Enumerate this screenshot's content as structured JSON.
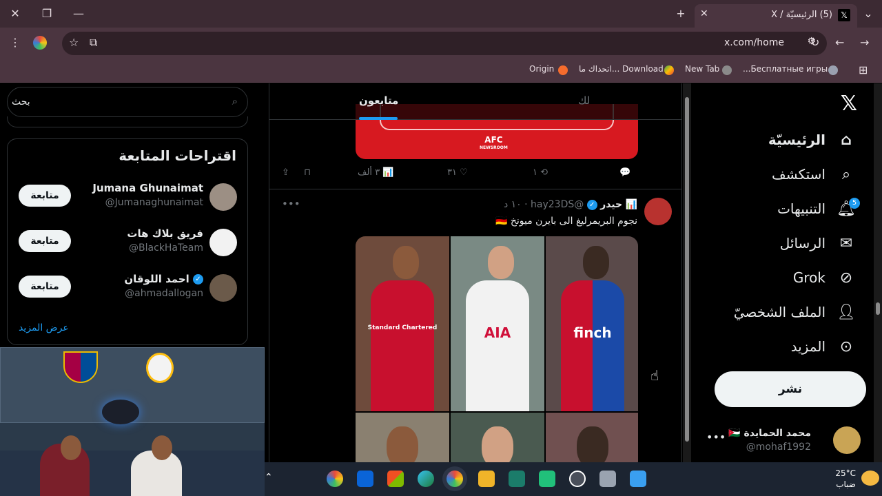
{
  "browser": {
    "tab_title": "(5) الرئيسيّة / X",
    "url": "x.com/home",
    "bookmarks": [
      {
        "label": "Origin"
      },
      {
        "label": "Download ...اتحداك ما"
      },
      {
        "label": "New Tab"
      },
      {
        "label": "Бесплатные игры..."
      }
    ]
  },
  "nav": {
    "items": [
      {
        "label": "الرئيسيّة",
        "icon": "home-icon"
      },
      {
        "label": "استكشف",
        "icon": "search-icon"
      },
      {
        "label": "التنبيهات",
        "icon": "bell-icon",
        "badge": "5"
      },
      {
        "label": "الرسائل",
        "icon": "mail-icon"
      },
      {
        "label": "Grok",
        "icon": "grok-icon"
      },
      {
        "label": "الملف الشخصيّ",
        "icon": "profile-icon"
      },
      {
        "label": "المزيد",
        "icon": "more-icon"
      }
    ],
    "post_label": "نشر",
    "me": {
      "name": "محمد الحمايدة 🇯🇴",
      "handle": "@mohaf1992"
    }
  },
  "timeline": {
    "tabs": {
      "for_you": "لك",
      "following": "متابعون"
    },
    "prev_tweet": {
      "card_brand": "AFC",
      "card_sub": "NEWSROOM",
      "replies": "",
      "retweets": "١",
      "likes": "٣١",
      "views": "٣ ألف"
    },
    "tweet": {
      "name": "حيدر",
      "handle": "@hay23DS",
      "time": "١٠ د",
      "text": "نجوم البريمرليغ الى بايرن ميونخ 🇩🇪",
      "image_labels": [
        "Standard Chartered",
        "AIA",
        "finch"
      ]
    }
  },
  "right": {
    "search_placeholder": "بحث",
    "who_to_follow_title": "اقتراحات المتابعة",
    "suggestions": [
      {
        "name": "Jumana Ghunaimat",
        "handle": "@Jumanaghunaimat",
        "follow": "متابعة"
      },
      {
        "name": "فريق بلاك هات",
        "handle": "@BlackHaTeam",
        "follow": "متابعة"
      },
      {
        "name": "احمد اللوقان",
        "handle": "@ahmadallogan",
        "follow": "متابعة"
      }
    ],
    "show_more": "عرض المزيد"
  },
  "taskbar": {
    "weather_temp": "25°C",
    "weather_desc": "ضباب"
  },
  "colors": {
    "accent": "#1d9bf0",
    "bg": "#000000",
    "chrome": "#4b3540"
  }
}
